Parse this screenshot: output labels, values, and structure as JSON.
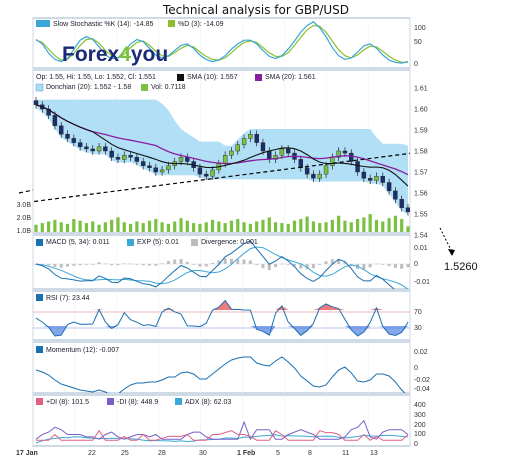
{
  "title": "Technical analysis for GBP/USD",
  "brand": {
    "name_a": "Forex",
    "name_b": "4",
    "name_c": "you"
  },
  "target_label": "1.5260",
  "colors": {
    "panel_border": "#7f9db9",
    "stoch_k": "#3aa7d6",
    "stoch_d": "#8bbf2f",
    "sma10": "#111111",
    "sma20": "#8a1ea0",
    "donchian_fill": "#a9dcf5",
    "volume": "#7ac142",
    "candle_up": "#7ac142",
    "candle_down": "#1d2f6b",
    "macd": "#1a6fb0",
    "ema": "#3aa7d6",
    "divergence": "#bdbdbd",
    "rsi": "#1a6fb0",
    "rsi_over": "#e64040",
    "rsi_under": "#4f7fe0",
    "momentum": "#1a6fb0",
    "plus_di": "#e06080",
    "minus_di": "#7b5fc8",
    "adx": "#3aa7d6"
  },
  "chart_data": [
    {
      "type": "line",
      "name": "stochastic",
      "legend": [
        "Slow Stochastic %K (14): -14.85",
        "%D (3): -14.09"
      ],
      "yticks": [
        "0",
        "50",
        "100"
      ],
      "k": [
        72,
        60,
        35,
        18,
        12,
        20,
        45,
        70,
        80,
        72,
        52,
        30,
        20,
        22,
        40,
        60,
        72,
        66,
        48,
        30,
        22,
        28,
        42,
        56,
        60,
        48,
        30,
        18,
        12,
        16,
        28,
        46,
        60,
        70,
        70,
        60,
        42,
        26,
        20,
        28,
        46,
        68,
        92,
        110,
        120,
        104,
        80,
        50,
        28,
        18,
        22,
        38,
        55,
        60,
        48,
        30,
        16,
        10,
        8,
        12
      ],
      "d": [
        70,
        64,
        46,
        28,
        16,
        18,
        34,
        56,
        72,
        74,
        62,
        42,
        28,
        22,
        32,
        50,
        64,
        68,
        56,
        40,
        28,
        26,
        36,
        48,
        56,
        52,
        38,
        26,
        18,
        16,
        22,
        36,
        52,
        64,
        68,
        64,
        50,
        36,
        26,
        26,
        36,
        56,
        78,
        98,
        110,
        108,
        92,
        68,
        44,
        28,
        22,
        30,
        44,
        54,
        52,
        40,
        26,
        16,
        10,
        10
      ]
    },
    {
      "type": "candlestick",
      "name": "price",
      "legend": [
        "Op: 1.55, Hi: 1.55, Lo: 1.552, Cl: 1.551",
        "SMA (10): 1.557",
        "SMA (20): 1.561",
        "Donchian (20): 1.552 - 1.58",
        "Vol: 0.7118"
      ],
      "yticks": [
        "1.54",
        "1.55",
        "1.56",
        "1.57",
        "1.58",
        "1.59",
        "1.60",
        "1.61"
      ],
      "vol_ticks": [
        "1.0B",
        "2.0B",
        "3.0B"
      ],
      "x_labels": [
        "17 Jan",
        "22",
        "25",
        "28",
        "30",
        "1 Feb",
        "5",
        "8",
        "11",
        "13"
      ],
      "close": [
        1.602,
        1.6,
        1.597,
        1.592,
        1.588,
        1.586,
        1.584,
        1.582,
        1.581,
        1.58,
        1.582,
        1.58,
        1.577,
        1.576,
        1.578,
        1.577,
        1.575,
        1.573,
        1.572,
        1.57,
        1.571,
        1.573,
        1.575,
        1.577,
        1.575,
        1.572,
        1.569,
        1.568,
        1.571,
        1.574,
        1.578,
        1.58,
        1.583,
        1.586,
        1.588,
        1.584,
        1.58,
        1.576,
        1.578,
        1.581,
        1.579,
        1.576,
        1.572,
        1.569,
        1.567,
        1.569,
        1.573,
        1.577,
        1.58,
        1.579,
        1.575,
        1.57,
        1.567,
        1.566,
        1.568,
        1.565,
        1.561,
        1.557,
        1.553,
        1.551
      ],
      "volume": [
        0.9,
        1.1,
        1.3,
        1.5,
        1.2,
        1.0,
        1.6,
        1.4,
        1.1,
        1.3,
        0.9,
        1.2,
        1.5,
        1.8,
        1.2,
        1.0,
        1.3,
        1.1,
        1.4,
        1.6,
        1.2,
        1.0,
        1.3,
        1.7,
        1.4,
        1.1,
        1.0,
        1.2,
        1.5,
        1.3,
        1.1,
        1.4,
        1.6,
        1.2,
        1.0,
        1.3,
        1.5,
        1.8,
        1.2,
        1.1,
        1.0,
        1.4,
        1.6,
        1.9,
        1.3,
        1.1,
        1.2,
        1.5,
        2.0,
        1.4,
        1.2,
        1.6,
        1.8,
        2.2,
        1.5,
        1.3,
        1.7,
        2.0,
        1.6,
        0.7
      ],
      "trendline": {
        "from": [
          0,
          1.556
        ],
        "to": [
          60,
          1.579
        ]
      }
    },
    {
      "type": "line",
      "name": "macd",
      "legend": [
        "MACD (5, 34): 0.011",
        "EXP (5): 0.01",
        "Divergence: 0.001"
      ],
      "yticks": [
        "-0.01",
        "0",
        "0.01"
      ]
    },
    {
      "type": "line",
      "name": "rsi",
      "legend": [
        "RSI (7): 23.44"
      ],
      "yticks": [
        "30",
        "70"
      ]
    },
    {
      "type": "line",
      "name": "momentum",
      "legend": [
        "Momentum (12): -0.007"
      ],
      "yticks": [
        "-0.04",
        "-0.02",
        "0",
        "0.02"
      ]
    },
    {
      "type": "line",
      "name": "dmi",
      "legend": [
        "+DI (8): 101.5",
        "-DI (8): 448.9",
        "ADX (8): 62.03"
      ],
      "yticks": [
        "0",
        "100",
        "200",
        "300",
        "400"
      ]
    }
  ]
}
